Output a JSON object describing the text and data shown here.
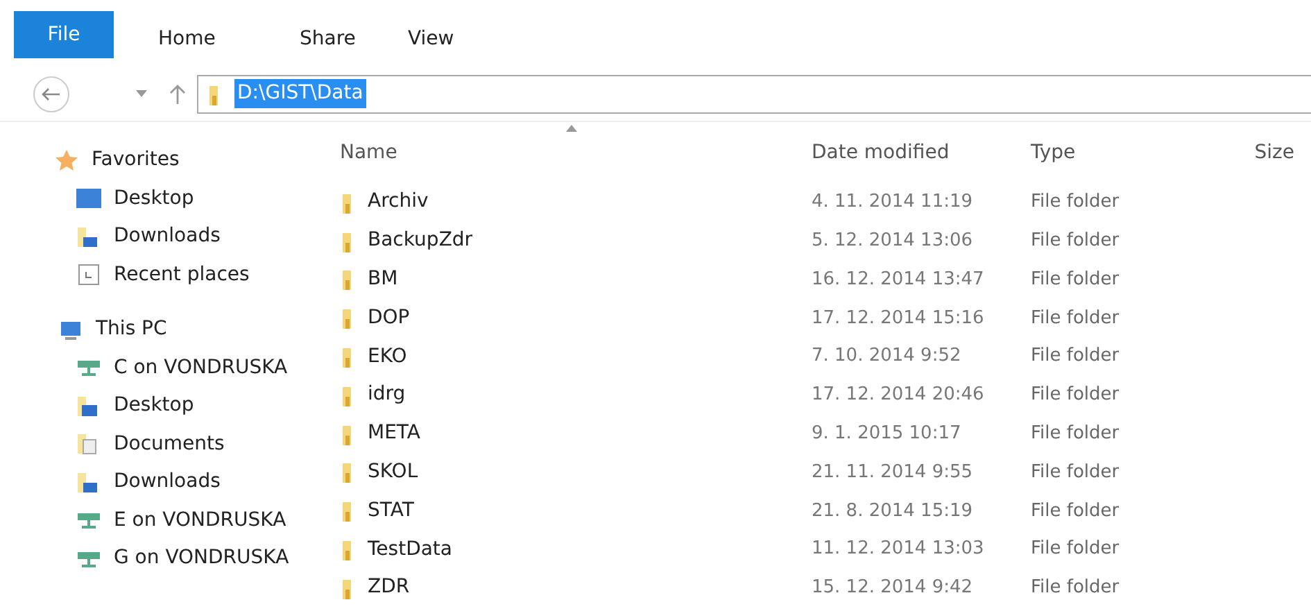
{
  "ribbon_tabs": [
    {
      "label": "File",
      "kind": "file"
    },
    {
      "label": "Home",
      "kind": "tab"
    },
    {
      "label": "Share",
      "kind": "tab"
    },
    {
      "label": "View",
      "kind": "tab"
    }
  ],
  "address_bar": {
    "path": "D:\\GIST\\Data",
    "selected": true
  },
  "sidebar": {
    "groups": [
      {
        "label": "Favorites",
        "kind": "favorites",
        "children": [
          {
            "label": "Desktop",
            "kind": "desktop"
          },
          {
            "label": "Downloads",
            "kind": "downloads"
          },
          {
            "label": "Recent places",
            "kind": "recent"
          }
        ]
      },
      {
        "label": "This PC",
        "kind": "pc",
        "children": [
          {
            "label": "C on VONDRUSKA",
            "kind": "drive"
          },
          {
            "label": "Desktop",
            "kind": "desktop-small"
          },
          {
            "label": "Documents",
            "kind": "documents"
          },
          {
            "label": "Downloads",
            "kind": "downloads"
          },
          {
            "label": "E on VONDRUSKA",
            "kind": "drive"
          },
          {
            "label": "G on VONDRUSKA",
            "kind": "drive"
          }
        ]
      }
    ]
  },
  "table": {
    "columns": [
      "Name",
      "Date modified",
      "Type",
      "Size"
    ],
    "rows": [
      {
        "name": "Archiv",
        "date_modified": "4. 11. 2014 11:19",
        "type": "File folder"
      },
      {
        "name": "BackupZdr",
        "date_modified": "5. 12. 2014 13:06",
        "type": "File folder"
      },
      {
        "name": "BM",
        "date_modified": "16. 12. 2014 13:47",
        "type": "File folder"
      },
      {
        "name": "DOP",
        "date_modified": "17. 12. 2014 15:16",
        "type": "File folder"
      },
      {
        "name": "EKO",
        "date_modified": "7. 10. 2014 9:52",
        "type": "File folder"
      },
      {
        "name": "idrg",
        "date_modified": "17. 12. 2014 20:46",
        "type": "File folder"
      },
      {
        "name": "META",
        "date_modified": "9. 1. 2015 10:17",
        "type": "File folder"
      },
      {
        "name": "SKOL",
        "date_modified": "21. 11. 2014 9:55",
        "type": "File folder"
      },
      {
        "name": "STAT",
        "date_modified": "21. 8. 2014 15:19",
        "type": "File folder"
      },
      {
        "name": "TestData",
        "date_modified": "11. 12. 2014 13:03",
        "type": "File folder"
      },
      {
        "name": "ZDR",
        "date_modified": "15. 12. 2014 9:42",
        "type": "File folder"
      }
    ]
  }
}
